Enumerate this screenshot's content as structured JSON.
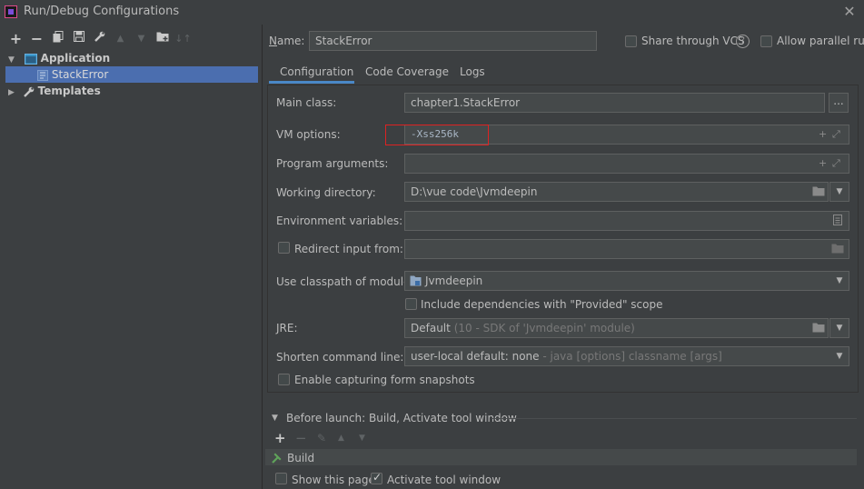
{
  "window": {
    "title": "Run/Debug Configurations"
  },
  "colors": {
    "accent": "#4b6eaf",
    "selection": "#4b6eaf",
    "highlight_box": "#dd2222",
    "tab_underline": "#4a88c7"
  },
  "left_toolbar": {
    "icons": [
      "add-icon",
      "remove-icon",
      "copy-icon",
      "save-icon",
      "wrench-icon",
      "move-up-icon",
      "move-down-icon",
      "folder-icon",
      "sort-icon"
    ]
  },
  "tree": {
    "application_label": "Application",
    "selected_item": "StackError",
    "templates_label": "Templates"
  },
  "header": {
    "name_label": "Name:",
    "name_value": "StackError",
    "share_vcs_label": "Share through VCS",
    "help_icon": "?",
    "allow_parallel_label": "Allow parallel run"
  },
  "tabs": [
    {
      "label": "Configuration"
    },
    {
      "label": "Code Coverage"
    },
    {
      "label": "Logs"
    }
  ],
  "form": {
    "main_class_label": "Main class:",
    "main_class_value": "chapter1.StackError",
    "browse_button": "...",
    "vm_options_label": "VM options:",
    "vm_options_value": "-Xss256k",
    "program_args_label": "Program arguments:",
    "program_args_value": "",
    "working_dir_label": "Working directory:",
    "working_dir_value": "D:\\vue code\\Jvmdeepin",
    "env_vars_label": "Environment variables:",
    "env_vars_value": "",
    "redirect_input_label": "Redirect input from:",
    "redirect_input_value": "",
    "classpath_module_label": "Use classpath of module:",
    "classpath_module_value": "Jvmdeepin",
    "include_deps_label": "Include dependencies with \"Provided\" scope",
    "jre_label": "JRE:",
    "jre_value_main": "Default",
    "jre_value_hint": "(10 - SDK of 'Jvmdeepin' module)",
    "shorten_cmd_label": "Shorten command line:",
    "shorten_cmd_value_main": "user-local default: none",
    "shorten_cmd_value_hint": " - java [options] classname [args]",
    "capture_snapshots_label": "Enable capturing form snapshots"
  },
  "before_launch": {
    "header": "Before launch: Build, Activate tool window",
    "tasks": [
      "Build"
    ]
  },
  "footer": {
    "show_page_label": "Show this page",
    "activate_tool_window_label": "Activate tool window",
    "show_page_checked": false,
    "activate_tool_window_checked": true
  }
}
